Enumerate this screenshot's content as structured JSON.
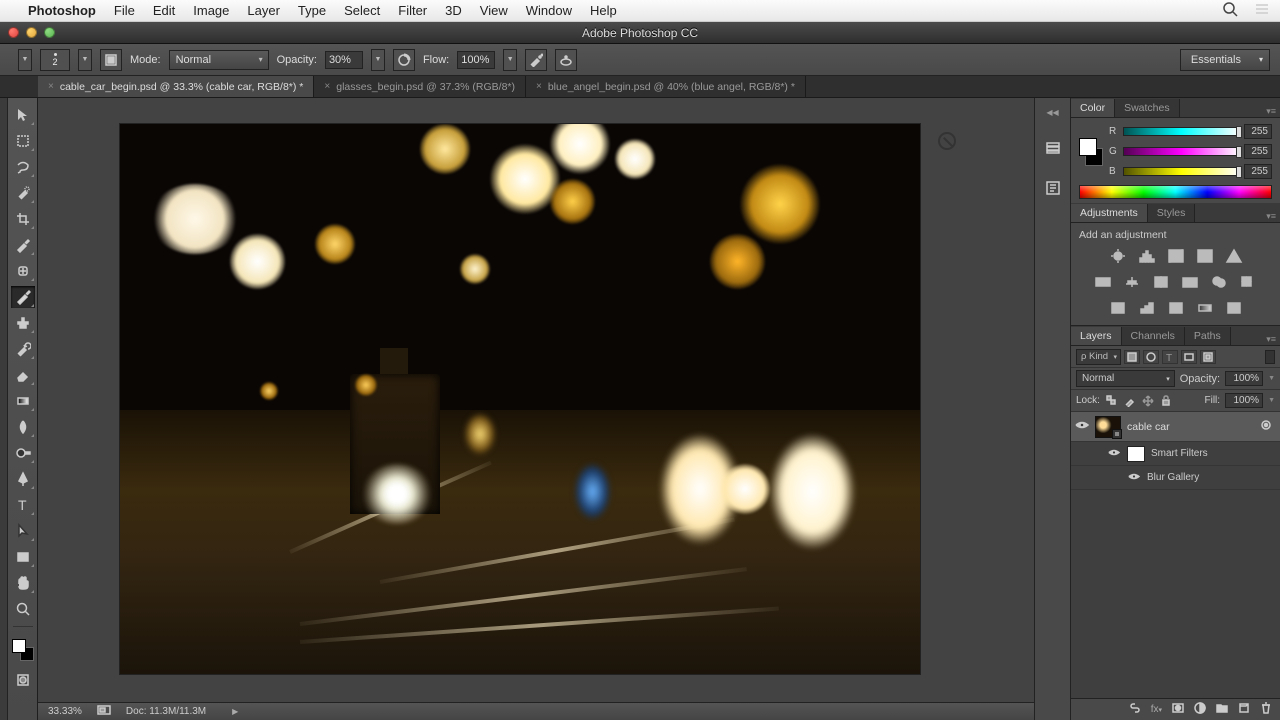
{
  "menubar": {
    "app_name": "Photoshop",
    "items": [
      "File",
      "Edit",
      "Image",
      "Layer",
      "Type",
      "Select",
      "Filter",
      "3D",
      "View",
      "Window",
      "Help"
    ]
  },
  "window": {
    "title": "Adobe Photoshop CC"
  },
  "options": {
    "brush_size": "2",
    "mode_label": "Mode:",
    "mode_value": "Normal",
    "opacity_label": "Opacity:",
    "opacity_value": "30%",
    "flow_label": "Flow:",
    "flow_value": "100%",
    "workspace": "Essentials"
  },
  "tabs": [
    {
      "label": "cable_car_begin.psd @ 33.3% (cable car, RGB/8*) *",
      "active": true
    },
    {
      "label": "glasses_begin.psd @ 37.3% (RGB/8*)",
      "active": false
    },
    {
      "label": "blue_angel_begin.psd @ 40% (blue angel, RGB/8*) *",
      "active": false
    }
  ],
  "status": {
    "zoom": "33.33%",
    "doc": "Doc: 11.3M/11.3M"
  },
  "color": {
    "tab_color": "Color",
    "tab_swatches": "Swatches",
    "r_label": "R",
    "g_label": "G",
    "b_label": "B",
    "r": "255",
    "g": "255",
    "b": "255"
  },
  "adjustments": {
    "tab_adj": "Adjustments",
    "tab_styles": "Styles",
    "add_label": "Add an adjustment"
  },
  "layers": {
    "tab_layers": "Layers",
    "tab_channels": "Channels",
    "tab_paths": "Paths",
    "kind_label": "ρ Kind",
    "blend_mode": "Normal",
    "opacity_label": "Opacity:",
    "opacity_value": "100%",
    "lock_label": "Lock:",
    "fill_label": "Fill:",
    "fill_value": "100%",
    "layer1_name": "cable car",
    "smart_filters": "Smart Filters",
    "blur_gallery": "Blur Gallery"
  }
}
